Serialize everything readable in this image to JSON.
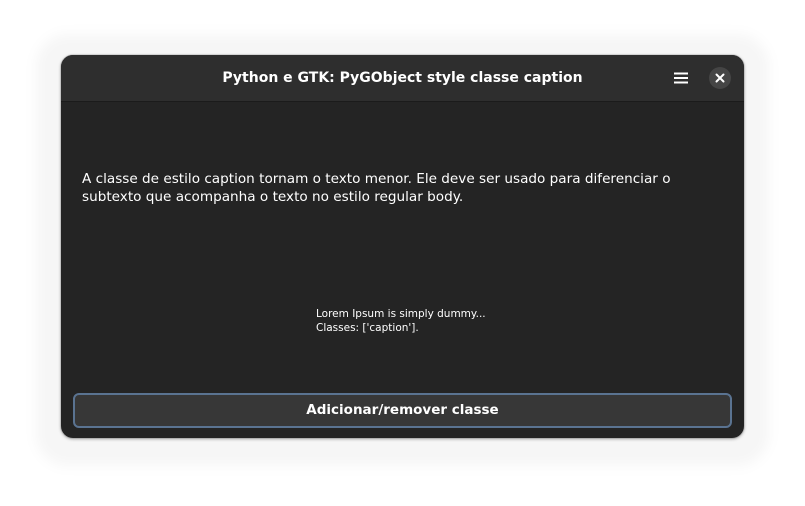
{
  "window": {
    "title": "Python e GTK: PyGObject style classe caption",
    "menu_icon": "hamburger-menu-icon",
    "close_icon": "close-icon"
  },
  "content": {
    "description": "A classe de estilo caption tornam o texto menor. Ele deve ser usado para diferenciar o subtexto que acompanha o texto no estilo regular body.",
    "sample_text": "Lorem Ipsum is simply dummy...",
    "classes_text": "Classes: ['caption']."
  },
  "actions": {
    "toggle_button_label": "Adicionar/remover classe"
  },
  "colors": {
    "window_bg": "#242424",
    "headerbar_bg": "#2e2e2e",
    "button_bg": "#373737",
    "focus_ring": "#5a7391",
    "text": "#ffffff"
  }
}
